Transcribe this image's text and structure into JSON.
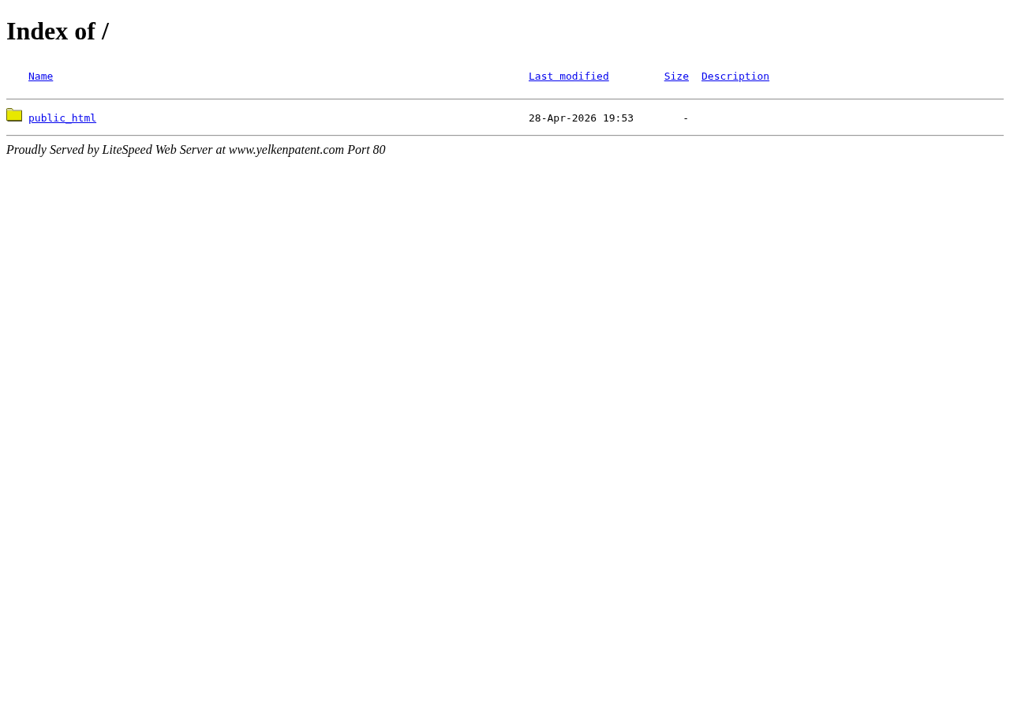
{
  "page": {
    "title": "Index of /"
  },
  "table": {
    "columns": [
      {
        "label": "Name"
      },
      {
        "label": "Last modified"
      },
      {
        "label": "Size"
      },
      {
        "label": "Description"
      }
    ],
    "rows": [
      {
        "kind": "directory",
        "name": "public_html",
        "last_modified": "28-Apr-2026 19:53",
        "size": "-"
      }
    ]
  },
  "footer": "Proudly Served by LiteSpeed Web Server at www.yelkenpatent.com Port 80"
}
